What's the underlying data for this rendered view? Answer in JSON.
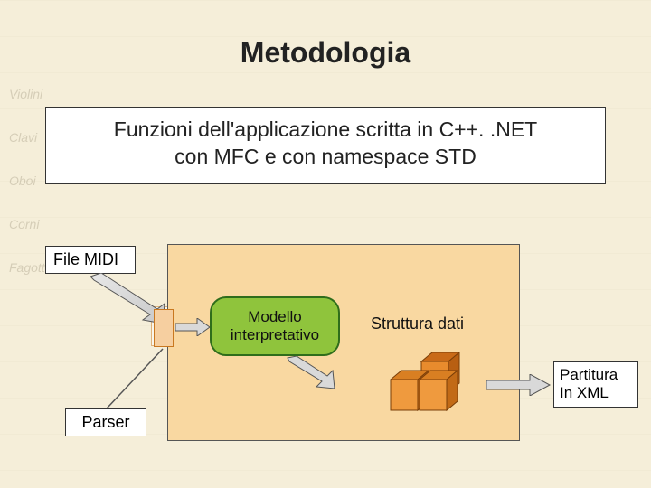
{
  "title": "Metodologia",
  "subtitle_line1": "Funzioni dell'applicazione scritta in C++. .NET",
  "subtitle_line2": "con MFC e con namespace STD",
  "file_midi_label": "File MIDI",
  "parser_label": "Parser",
  "model_line1": "Modello",
  "model_line2": "interpretativo",
  "struct_label": "Struttura dati",
  "output_line1": "Partitura",
  "output_line2": "In XML",
  "colors": {
    "slide_bg": "#f5eed9",
    "panel_bg": "#f9d8a1",
    "model_fill": "#8fc43c",
    "model_border": "#2f6d1b",
    "cube_fill": "#e88b2d",
    "cube_dark": "#b85f12",
    "arrow_fill": "#d9d9d9",
    "arrow_stroke": "#555"
  }
}
